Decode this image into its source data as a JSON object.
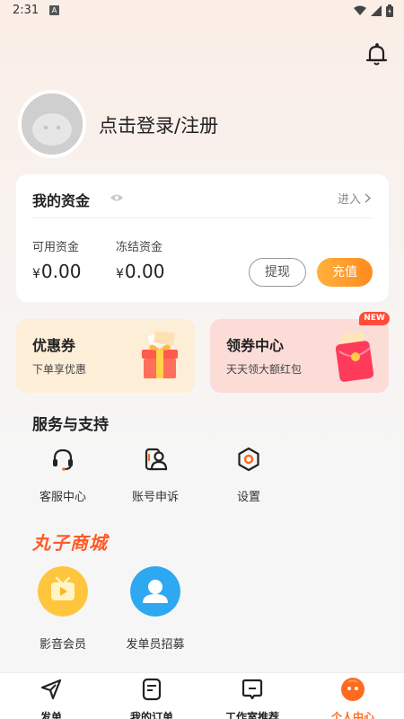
{
  "status": {
    "time": "2:31",
    "notif_letter": "A"
  },
  "header": {
    "bell_icon": "bell-icon"
  },
  "profile": {
    "login_text": "点击登录/注册",
    "avatar_icon": "avatar"
  },
  "funds": {
    "title": "我的资金",
    "enter_label": "进入",
    "available_label": "可用资金",
    "available_currency": "¥",
    "available_value": "0.00",
    "frozen_label": "冻结资金",
    "frozen_currency": "¥",
    "frozen_value": "0.00",
    "withdraw_label": "提现",
    "recharge_label": "充值"
  },
  "coupons": {
    "left_title": "优惠券",
    "left_sub": "下单享优惠",
    "right_title": "领券中心",
    "right_sub": "天天领大额红包",
    "new_badge": "NEW"
  },
  "services": {
    "title": "服务与支持",
    "items": [
      {
        "label": "客服中心",
        "icon": "headset-icon"
      },
      {
        "label": "账号申诉",
        "icon": "user-card-icon"
      },
      {
        "label": "设置",
        "icon": "gear-icon"
      }
    ]
  },
  "mall": {
    "title": "丸子商城",
    "items": [
      {
        "label": "影音会员",
        "icon": "tv-icon"
      },
      {
        "label": "发单员招募",
        "icon": "person-icon"
      }
    ]
  },
  "tabs": [
    {
      "label": "发单",
      "icon": "send-icon"
    },
    {
      "label": "我的订单",
      "icon": "order-icon"
    },
    {
      "label": "工作室推荐",
      "icon": "studio-icon"
    },
    {
      "label": "个人中心",
      "icon": "profile-icon",
      "active": true
    }
  ],
  "colors": {
    "accent": "#ff6a1f",
    "recharge": "#ff9a2a",
    "mall_title": "#ff5a28"
  }
}
